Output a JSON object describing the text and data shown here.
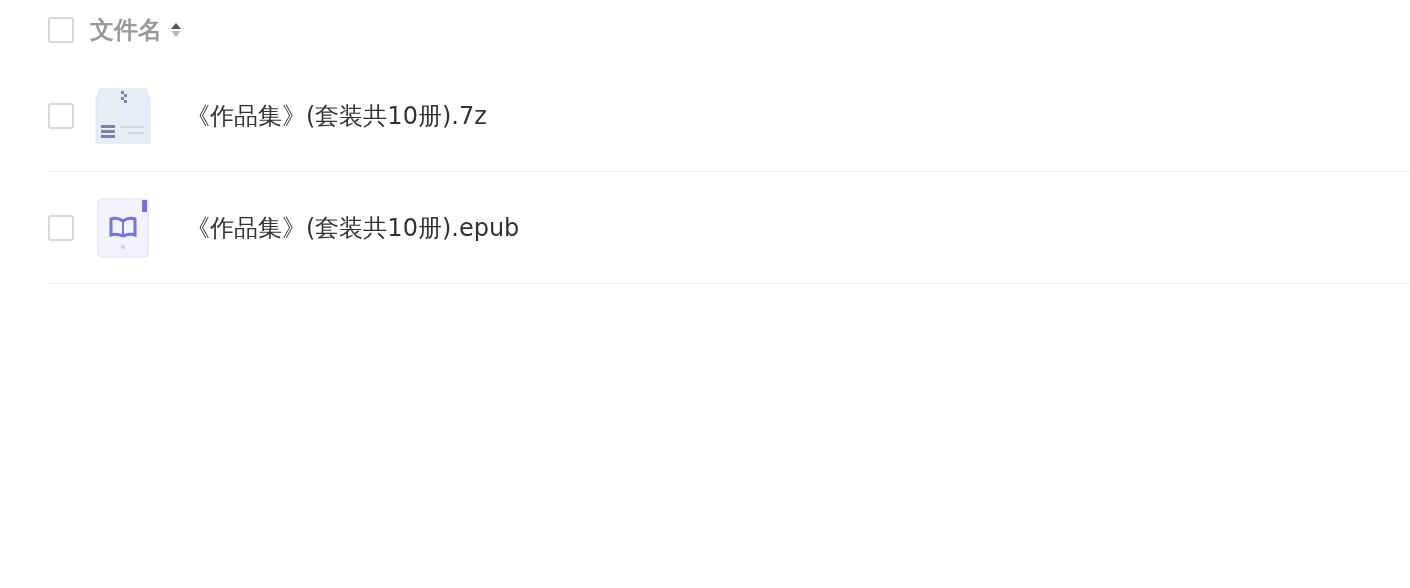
{
  "header": {
    "checked": false,
    "label": "文件名",
    "sort_ascending": true
  },
  "files": [
    {
      "kind": "archive",
      "name": "《作品集》(套装共10册).7z",
      "checked": false
    },
    {
      "kind": "ebook",
      "name": "《作品集》(套装共10册).epub",
      "checked": false
    }
  ]
}
